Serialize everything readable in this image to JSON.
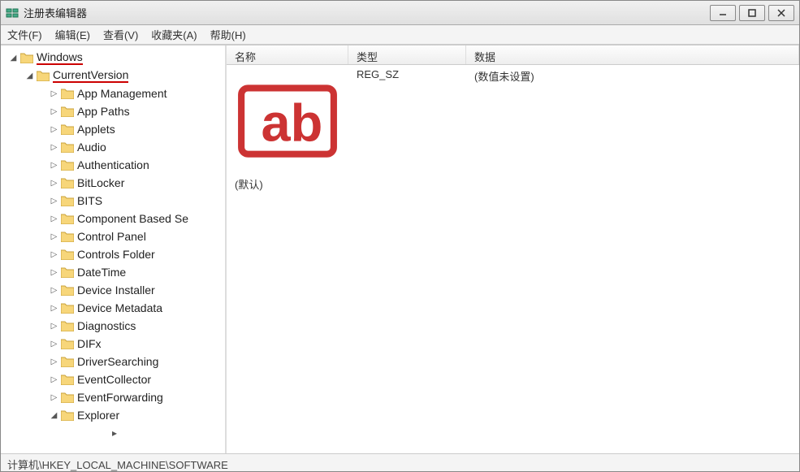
{
  "window": {
    "title": "注册表编辑器"
  },
  "menu": {
    "file": "文件(F)",
    "edit": "编辑(E)",
    "view": "查看(V)",
    "favorites": "收藏夹(A)",
    "help": "帮助(H)"
  },
  "tree": {
    "root": "Windows",
    "current": "CurrentVersion",
    "children": [
      "App Management",
      "App Paths",
      "Applets",
      "Audio",
      "Authentication",
      "BitLocker",
      "BITS",
      "Component Based Se",
      "Control Panel",
      "Controls Folder",
      "DateTime",
      "Device Installer",
      "Device Metadata",
      "Diagnostics",
      "DIFx",
      "DriverSearching",
      "EventCollector",
      "EventForwarding",
      "Explorer"
    ]
  },
  "list": {
    "headers": {
      "name": "名称",
      "type": "类型",
      "data": "数据"
    },
    "rows": [
      {
        "name": "(默认)",
        "type": "REG_SZ",
        "data": "(数值未设置)"
      }
    ]
  },
  "statusbar": {
    "path": "计算机\\HKEY_LOCAL_MACHINE\\SOFTWARE"
  }
}
